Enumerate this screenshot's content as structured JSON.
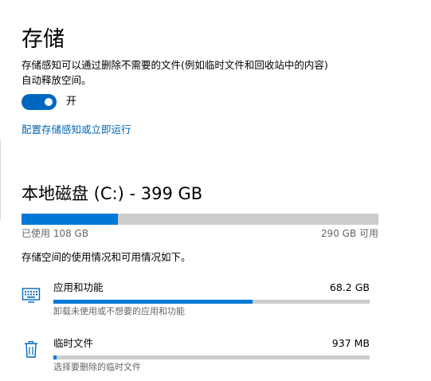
{
  "header": {
    "title": "存储"
  },
  "storage_sense": {
    "description_line1": "存储感知可以通过删除不需要的文件(例如临时文件和回收站中的内容)",
    "description_line2": "自动释放空间。",
    "toggle_state": "on",
    "toggle_label": "开",
    "configure_link": "配置存储感知或立即运行"
  },
  "drive": {
    "title": "本地磁盘 (C:) - 399 GB",
    "used_label": "已使用 108 GB",
    "free_label": "290 GB 可用",
    "used_fraction": 0.27,
    "summary": "存储空间的使用情况和可用情况如下。"
  },
  "categories": [
    {
      "name": "应用和功能",
      "size": "68.2 GB",
      "subtitle": "卸载未使用或不想要的应用和功能",
      "icon": "keyboard-icon",
      "fill_fraction": 0.63
    },
    {
      "name": "临时文件",
      "size": "937 MB",
      "subtitle": "选择要删除的临时文件",
      "icon": "trash-icon",
      "fill_fraction": 0.01
    }
  ],
  "colors": {
    "accent": "#0078d7",
    "link": "#0066b4",
    "toggle": "#0067c0",
    "track": "#cccccc",
    "secondary_text": "#666666"
  }
}
